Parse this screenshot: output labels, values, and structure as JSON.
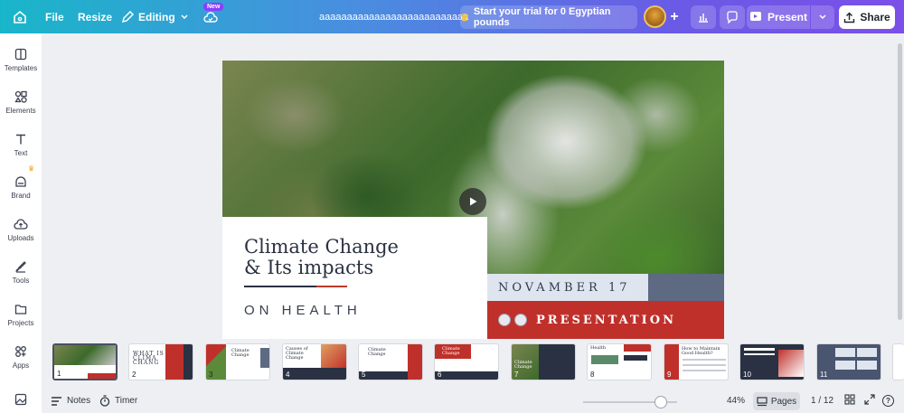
{
  "topbar": {
    "file_label": "File",
    "resize_label": "Resize",
    "editing_label": "Editing",
    "new_badge": "New",
    "doc_title": "aaaaaaaaaaaaaaaaaaaaaaaaaaa",
    "trial_label": "Start your trial for 0 Egyptian pounds",
    "present_label": "Present",
    "share_label": "Share"
  },
  "sidebar": {
    "items": [
      {
        "label": "Templates",
        "icon": "templates-icon"
      },
      {
        "label": "Elements",
        "icon": "elements-icon"
      },
      {
        "label": "Text",
        "icon": "text-icon"
      },
      {
        "label": "Brand",
        "icon": "brand-icon"
      },
      {
        "label": "Uploads",
        "icon": "uploads-icon"
      },
      {
        "label": "Tools",
        "icon": "tools-icon"
      },
      {
        "label": "Projects",
        "icon": "projects-icon"
      },
      {
        "label": "Apps",
        "icon": "apps-icon"
      }
    ]
  },
  "slide": {
    "title": "Climate Change\n& Its impacts",
    "subtitle": "ON HEALTH",
    "date": "NOVAMBER 17",
    "presentation": "PRESENTATION"
  },
  "thumbs": [
    {
      "num": "1",
      "text": ""
    },
    {
      "num": "2",
      "text": "WHAT IS\nCLIMA\nCHANG"
    },
    {
      "num": "3",
      "text": "Climate\nChange"
    },
    {
      "num": "4",
      "text": "Causes of\nClimate\nChange"
    },
    {
      "num": "5",
      "text": "Climate\nChange"
    },
    {
      "num": "6",
      "text": "Climate\nChange"
    },
    {
      "num": "7",
      "text": "Climate\nChange"
    },
    {
      "num": "8",
      "text": "Health"
    },
    {
      "num": "9",
      "text": "How to Maintain\nGood Health?"
    },
    {
      "num": "10",
      "text": ""
    },
    {
      "num": "11",
      "text": ""
    }
  ],
  "bottombar": {
    "notes_label": "Notes",
    "timer_label": "Timer",
    "zoom": "44%",
    "pages_label": "Pages",
    "page_counter": "1 / 12"
  },
  "colors": {
    "accent_red": "#c0302b",
    "navy": "#2a3142",
    "purple": "#8b3dff"
  }
}
